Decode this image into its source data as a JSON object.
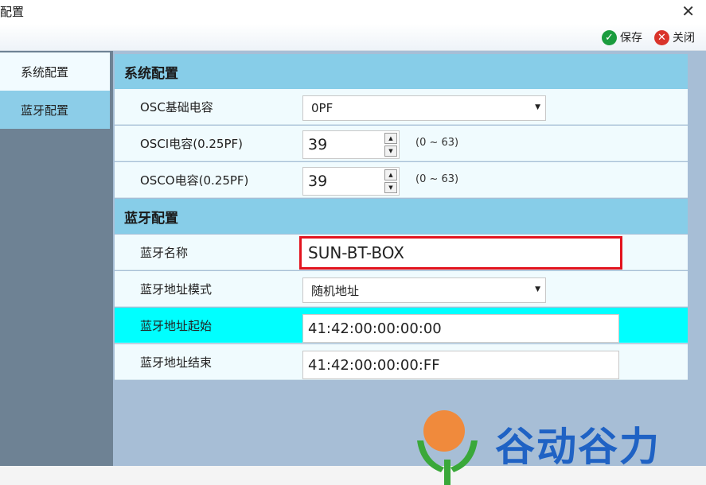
{
  "window": {
    "title": "配置",
    "close_glyph": "✕"
  },
  "toolbar": {
    "save_label": "保存",
    "close_label": "关闭",
    "save_icon": "check-circle-icon",
    "close_icon": "x-circle-icon",
    "save_glyph": "✓",
    "close_glyph": "✕"
  },
  "sidebar": {
    "items": [
      {
        "label": "系统配置"
      },
      {
        "label": "蓝牙配置"
      }
    ]
  },
  "system_section": {
    "header": "系统配置",
    "rows": [
      {
        "label": "OSC基础电容",
        "type": "select",
        "value": "0PF"
      },
      {
        "label": "OSCI电容(0.25PF)",
        "type": "spin",
        "value": "39",
        "range": "(0 ~ 63)"
      },
      {
        "label": "OSCO电容(0.25PF)",
        "type": "spin",
        "value": "39",
        "range": "(0 ~ 63)"
      }
    ]
  },
  "bluetooth_section": {
    "header": "蓝牙配置",
    "rows": [
      {
        "label": "蓝牙名称",
        "type": "text",
        "value": "SUN-BT-BOX"
      },
      {
        "label": "蓝牙地址模式",
        "type": "select",
        "value": "随机地址"
      },
      {
        "label": "蓝牙地址起始",
        "type": "text",
        "value": "41:42:00:00:00:00"
      },
      {
        "label": "蓝牙地址结束",
        "type": "text",
        "value": "41:42:00:00:00:FF"
      }
    ]
  },
  "watermark": {
    "brand_text": "谷动谷力"
  },
  "colors": {
    "section_header": "#87cde8",
    "highlight_row": "#00ffff",
    "sidebar_bg": "#6e8294",
    "sidebar_active": "#8ccde8",
    "main_bg": "#a7bed6",
    "focus_border": "#e3131e",
    "save_icon": "#1a9c3e",
    "close_icon": "#d9342b",
    "logo_orange": "#f08a3c",
    "logo_green": "#3aa83a",
    "logo_blue": "#1f62c4"
  }
}
